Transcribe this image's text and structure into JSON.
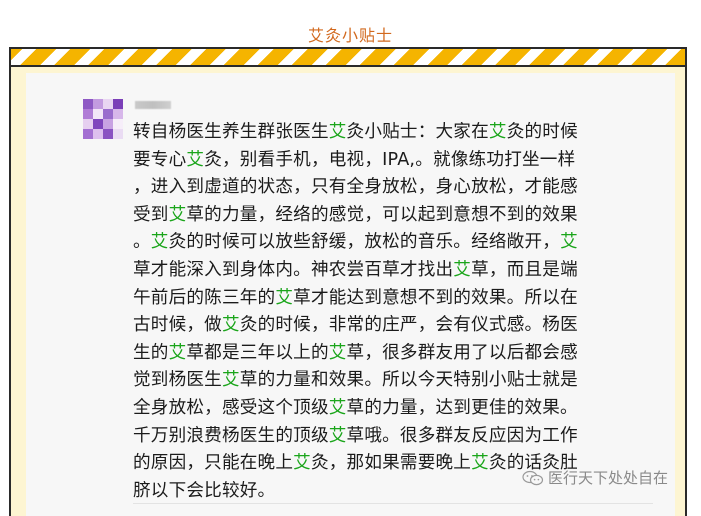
{
  "header": {
    "title": "艾灸小贴士"
  },
  "colors": {
    "title": "#d2691e",
    "stripe_yellow": "#f5b400",
    "panel_bg": "#fdf5d2",
    "card_bg": "#f7f7f7",
    "highlight": "#1aa51a"
  },
  "chat": {
    "avatar": {
      "icon": "pixelated-avatar-icon"
    },
    "sender_name": "",
    "lines": [
      [
        {
          "t": "转自杨医生养生群张医生"
        },
        {
          "t": "艾",
          "hl": true
        },
        {
          "t": "灸小贴士：大家在"
        },
        {
          "t": "艾",
          "hl": true
        },
        {
          "t": "灸的时候"
        }
      ],
      [
        {
          "t": "要专心"
        },
        {
          "t": "艾",
          "hl": true
        },
        {
          "t": "灸，别看手机，电视，IPA,。就像练功打坐一样"
        }
      ],
      [
        {
          "t": "，进入到虚道的状态，只有全身放松，身心放松，才能感"
        }
      ],
      [
        {
          "t": "受到"
        },
        {
          "t": "艾",
          "hl": true
        },
        {
          "t": "草的力量，经络的感觉，可以起到意想不到的效果"
        }
      ],
      [
        {
          "t": "。"
        },
        {
          "t": "艾",
          "hl": true
        },
        {
          "t": "灸的时候可以放些舒缓，放松的音乐。经络敞开，"
        },
        {
          "t": "艾",
          "hl": true
        }
      ],
      [
        {
          "t": "草才能深入到身体内。神农尝百草才找出"
        },
        {
          "t": "艾",
          "hl": true
        },
        {
          "t": "草，而且是端"
        }
      ],
      [
        {
          "t": "午前后的陈三年的"
        },
        {
          "t": "艾",
          "hl": true
        },
        {
          "t": "草才能达到意想不到的效果。所以在"
        }
      ],
      [
        {
          "t": "古时候，做"
        },
        {
          "t": "艾",
          "hl": true
        },
        {
          "t": "灸的时候，非常的庄严，会有仪式感。杨医"
        }
      ],
      [
        {
          "t": "生的"
        },
        {
          "t": "艾",
          "hl": true
        },
        {
          "t": "草都是三年以上的"
        },
        {
          "t": "艾",
          "hl": true
        },
        {
          "t": "草，很多群友用了以后都会感"
        }
      ],
      [
        {
          "t": "觉到杨医生"
        },
        {
          "t": "艾",
          "hl": true
        },
        {
          "t": "草的力量和效果。所以今天特别小贴士就是"
        }
      ],
      [
        {
          "t": "全身放松，感受这个顶级"
        },
        {
          "t": "艾",
          "hl": true
        },
        {
          "t": "草的力量，达到更佳的效果。"
        }
      ],
      [
        {
          "t": "千万别浪费杨医生的顶级"
        },
        {
          "t": "艾",
          "hl": true
        },
        {
          "t": "草哦。很多群友反应因为工作"
        }
      ],
      [
        {
          "t": "的原因，只能在晚上"
        },
        {
          "t": "艾",
          "hl": true
        },
        {
          "t": "灸，那如果需要晚上"
        },
        {
          "t": "艾",
          "hl": true
        },
        {
          "t": "灸的话灸肚"
        }
      ],
      [
        {
          "t": "脐以下会比较好。"
        }
      ]
    ]
  },
  "watermark": {
    "icon": "wechat-icon",
    "text": "医行天下处处自在"
  }
}
